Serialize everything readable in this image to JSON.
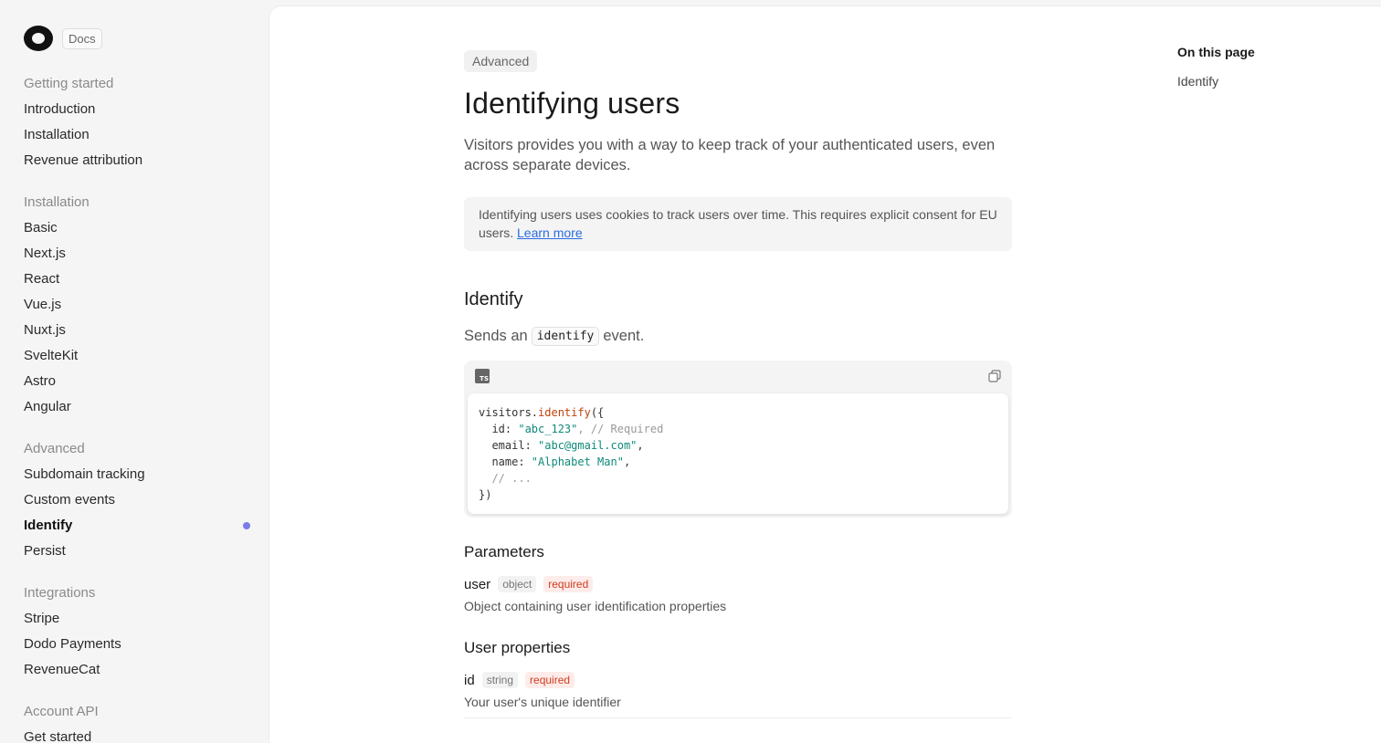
{
  "brand": {
    "badge": "Docs"
  },
  "sidebar": {
    "sections": [
      {
        "heading": "Getting started",
        "items": [
          "Introduction",
          "Installation",
          "Revenue attribution"
        ]
      },
      {
        "heading": "Installation",
        "items": [
          "Basic",
          "Next.js",
          "React",
          "Vue.js",
          "Nuxt.js",
          "SvelteKit",
          "Astro",
          "Angular"
        ]
      },
      {
        "heading": "Advanced",
        "items": [
          "Subdomain tracking",
          "Custom events",
          "Identify",
          "Persist"
        ]
      },
      {
        "heading": "Integrations",
        "items": [
          "Stripe",
          "Dodo Payments",
          "RevenueCat"
        ]
      },
      {
        "heading": "Account API",
        "items": [
          "Get started"
        ]
      }
    ],
    "active_item": "Identify",
    "active_dot_color": "#7b7ce8"
  },
  "main": {
    "category": "Advanced",
    "title": "Identifying users",
    "lead": "Visitors provides you with a way to keep track of your authenticated users, even across separate devices.",
    "notice": {
      "text": "Identifying users uses cookies to track users over time. This requires explicit consent for EU users. ",
      "link": "Learn more"
    },
    "section_title": "Identify",
    "sends_prefix": "Sends an",
    "sends_code": "identify",
    "sends_suffix": "event.",
    "code_lang_icon": "TS",
    "code": {
      "obj": "visitors.",
      "fn": "identify",
      "open": "({",
      "id_key": "  id: ",
      "id_val": "\"abc_123\"",
      "id_comment": ", // Required",
      "email_key": "  email: ",
      "email_val": "\"abc@gmail.com\"",
      "comma": ",",
      "name_key": "  name: ",
      "name_val": "\"Alphabet Man\"",
      "more": "  // ...",
      "close": "})"
    },
    "parameters": {
      "title": "Parameters",
      "name": "user",
      "type": "object",
      "required": "required",
      "description": "Object containing user identification properties"
    },
    "user_properties": {
      "title": "User properties",
      "name": "id",
      "type": "string",
      "required": "required",
      "description": "Your user's unique identifier"
    }
  },
  "toc": {
    "title": "On this page",
    "items": [
      "Identify"
    ]
  }
}
